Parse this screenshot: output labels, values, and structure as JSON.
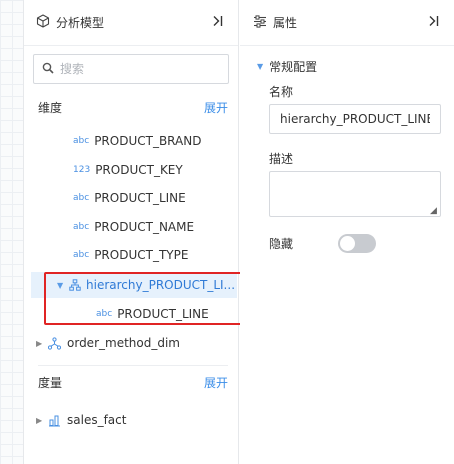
{
  "model_panel": {
    "title": "分析模型",
    "collapse_icon": "collapse-right-icon",
    "search": {
      "placeholder": "搜索",
      "value": ""
    },
    "dimensions": {
      "label": "维度",
      "expand_label": "展开",
      "items": [
        {
          "type_tag": "abc",
          "name": "PRODUCT_BRAND"
        },
        {
          "type_tag": "123",
          "name": "PRODUCT_KEY"
        },
        {
          "type_tag": "abc",
          "name": "PRODUCT_LINE"
        },
        {
          "type_tag": "abc",
          "name": "PRODUCT_NAME"
        },
        {
          "type_tag": "abc",
          "name": "PRODUCT_TYPE"
        }
      ],
      "hierarchy": {
        "name": "hierarchy_PRODUCT_LI...",
        "expanded": true,
        "children": [
          {
            "type_tag": "abc",
            "name": "PRODUCT_LINE"
          }
        ]
      },
      "dim_group": {
        "name": "order_method_dim",
        "expanded": false
      }
    },
    "measures": {
      "label": "度量",
      "expand_label": "展开",
      "items": [
        {
          "name": "sales_fact",
          "expanded": false
        }
      ]
    }
  },
  "prop_panel": {
    "title": "属性",
    "collapse_icon": "collapse-right-icon",
    "group_title": "常规配置",
    "name_label": "名称",
    "name_value": "hierarchy_PRODUCT_LINE",
    "desc_label": "描述",
    "desc_value": "",
    "hidden_label": "隐藏",
    "hidden_enabled": false
  },
  "colors": {
    "accent": "#3b8ee8",
    "selection_bg": "#e6f1fc",
    "highlight_border": "#e02424",
    "toggle_off": "#c8cbd0"
  }
}
